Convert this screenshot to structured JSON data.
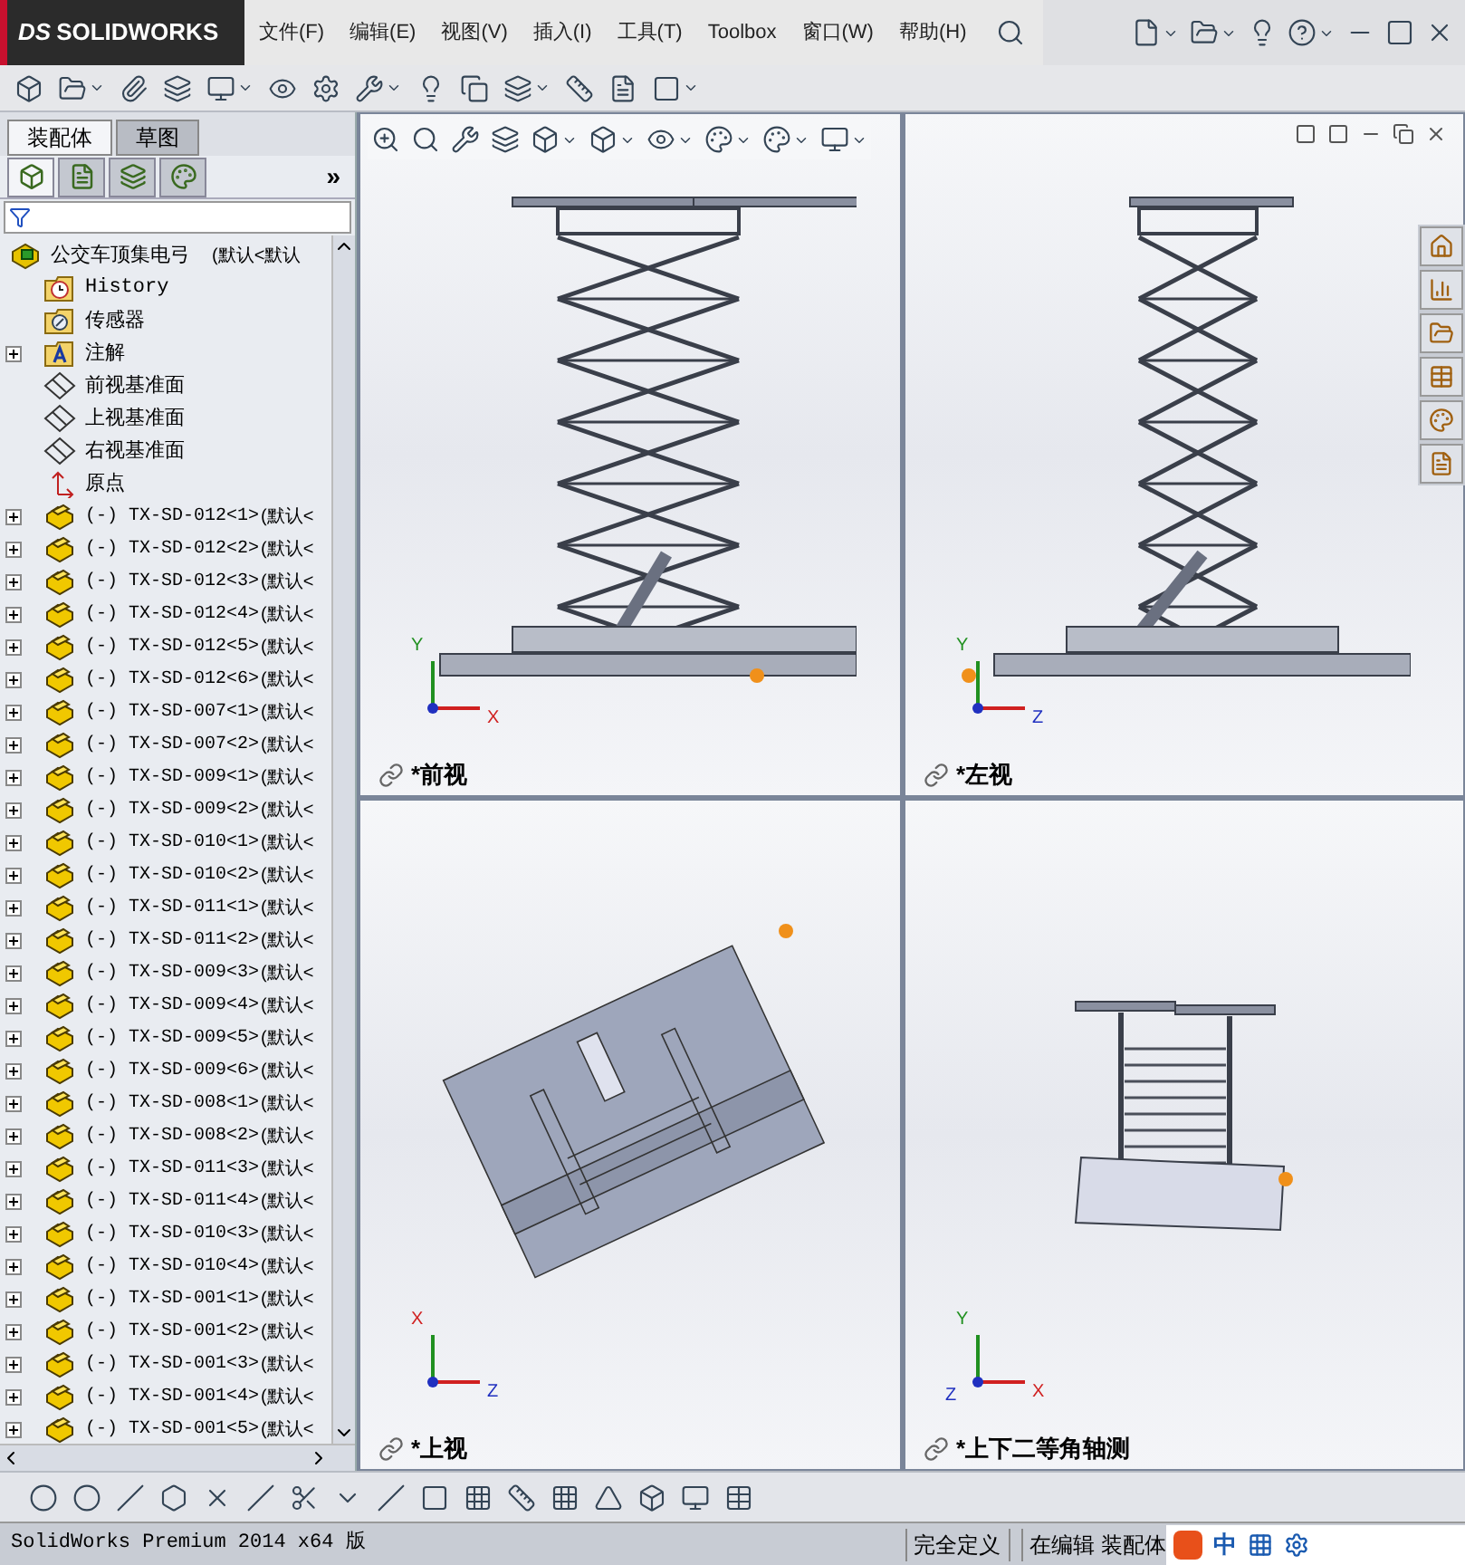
{
  "logo": {
    "mark": "DS",
    "name": "SOLIDWORKS"
  },
  "menu": [
    "文件(F)",
    "编辑(E)",
    "视图(V)",
    "插入(I)",
    "工具(T)",
    "Toolbox",
    "窗口(W)",
    "帮助(H)"
  ],
  "panel_tabs": [
    {
      "label": "装配体",
      "selected": true
    },
    {
      "label": "草图",
      "selected": false
    }
  ],
  "panel_icon_tabs": [
    {
      "kind": "tree",
      "selected": true
    },
    {
      "kind": "property",
      "selected": false
    },
    {
      "kind": "config",
      "selected": false
    },
    {
      "kind": "appearance",
      "selected": false
    }
  ],
  "panel_more": "»",
  "tree": [
    {
      "kind": "assembly",
      "name": "公交车顶集电弓",
      "config": "(默认<默认"
    },
    {
      "kind": "history",
      "name": "History"
    },
    {
      "kind": "sensor",
      "name": "传感器"
    },
    {
      "kind": "annotation",
      "name": "注解",
      "expanded": false
    },
    {
      "kind": "plane",
      "name": "前视基准面"
    },
    {
      "kind": "plane",
      "name": "上视基准面"
    },
    {
      "kind": "plane",
      "name": "右视基准面"
    },
    {
      "kind": "origin",
      "name": "原点"
    },
    {
      "kind": "part",
      "name": "(-) TX-SD-012<1>",
      "config": "(默认<",
      "expanded": false
    },
    {
      "kind": "part",
      "name": "(-) TX-SD-012<2>",
      "config": "(默认<",
      "expanded": false
    },
    {
      "kind": "part",
      "name": "(-) TX-SD-012<3>",
      "config": "(默认<",
      "expanded": false
    },
    {
      "kind": "part",
      "name": "(-) TX-SD-012<4>",
      "config": "(默认<",
      "expanded": false
    },
    {
      "kind": "part",
      "name": "(-) TX-SD-012<5>",
      "config": "(默认<",
      "expanded": false
    },
    {
      "kind": "part",
      "name": "(-) TX-SD-012<6>",
      "config": "(默认<",
      "expanded": false
    },
    {
      "kind": "part",
      "name": "(-) TX-SD-007<1>",
      "config": "(默认<",
      "expanded": false
    },
    {
      "kind": "part",
      "name": "(-) TX-SD-007<2>",
      "config": "(默认<",
      "expanded": false
    },
    {
      "kind": "part",
      "name": "(-) TX-SD-009<1>",
      "config": "(默认<",
      "expanded": false
    },
    {
      "kind": "part",
      "name": "(-) TX-SD-009<2>",
      "config": "(默认<",
      "expanded": false
    },
    {
      "kind": "part",
      "name": "(-) TX-SD-010<1>",
      "config": "(默认<",
      "expanded": false
    },
    {
      "kind": "part",
      "name": "(-) TX-SD-010<2>",
      "config": "(默认<",
      "expanded": false
    },
    {
      "kind": "part",
      "name": "(-) TX-SD-011<1>",
      "config": "(默认<",
      "expanded": false
    },
    {
      "kind": "part",
      "name": "(-) TX-SD-011<2>",
      "config": "(默认<",
      "expanded": false
    },
    {
      "kind": "part",
      "name": "(-) TX-SD-009<3>",
      "config": "(默认<",
      "expanded": false
    },
    {
      "kind": "part",
      "name": "(-) TX-SD-009<4>",
      "config": "(默认<",
      "expanded": false
    },
    {
      "kind": "part",
      "name": "(-) TX-SD-009<5>",
      "config": "(默认<",
      "expanded": false
    },
    {
      "kind": "part",
      "name": "(-) TX-SD-009<6>",
      "config": "(默认<",
      "expanded": false
    },
    {
      "kind": "part",
      "name": "(-) TX-SD-008<1>",
      "config": "(默认<",
      "expanded": false
    },
    {
      "kind": "part",
      "name": "(-) TX-SD-008<2>",
      "config": "(默认<",
      "expanded": false
    },
    {
      "kind": "part",
      "name": "(-) TX-SD-011<3>",
      "config": "(默认<",
      "expanded": false
    },
    {
      "kind": "part",
      "name": "(-) TX-SD-011<4>",
      "config": "(默认<",
      "expanded": false
    },
    {
      "kind": "part",
      "name": "(-) TX-SD-010<3>",
      "config": "(默认<",
      "expanded": false
    },
    {
      "kind": "part",
      "name": "(-) TX-SD-010<4>",
      "config": "(默认<",
      "expanded": false
    },
    {
      "kind": "part",
      "name": "(-) TX-SD-001<1>",
      "config": "(默认<",
      "expanded": false
    },
    {
      "kind": "part",
      "name": "(-) TX-SD-001<2>",
      "config": "(默认<",
      "expanded": false
    },
    {
      "kind": "part",
      "name": "(-) TX-SD-001<3>",
      "config": "(默认<",
      "expanded": false
    },
    {
      "kind": "part",
      "name": "(-) TX-SD-001<4>",
      "config": "(默认<",
      "expanded": false
    },
    {
      "kind": "part",
      "name": "(-) TX-SD-001<5>",
      "config": "(默认<",
      "expanded": false
    }
  ],
  "viewports": [
    {
      "kind": "front",
      "label": "*前视",
      "axes": [
        "Y",
        "X"
      ]
    },
    {
      "kind": "left",
      "label": "*左视",
      "axes": [
        "Y",
        "Z"
      ]
    },
    {
      "kind": "top",
      "label": "*上视",
      "axes": [
        "X",
        "Z"
      ]
    },
    {
      "kind": "iso",
      "label": "*上下二等角轴测",
      "axes": [
        "Y",
        "X",
        "Z"
      ]
    }
  ],
  "status_bar": {
    "product": "SolidWorks Premium 2014 x64 版",
    "state": "完全定义",
    "mode": "在编辑 装配体"
  },
  "ime": {
    "label": "中"
  }
}
